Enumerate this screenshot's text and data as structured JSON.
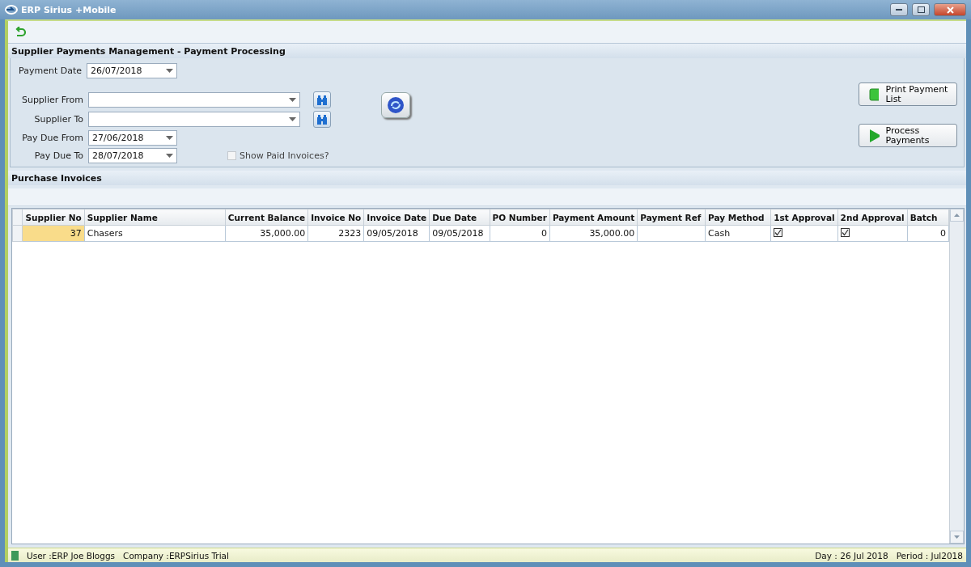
{
  "window": {
    "title": "ERP Sirius +Mobile"
  },
  "section_title": "Supplier Payments Management - Payment Processing",
  "payment_date": {
    "label": "Payment Date",
    "value": "26/07/2018"
  },
  "supplier_from": {
    "label": "Supplier From"
  },
  "supplier_to": {
    "label": "Supplier To"
  },
  "pay_due_from": {
    "label": "Pay Due From",
    "value": "27/06/2018"
  },
  "pay_due_to": {
    "label": "Pay Due To",
    "value": "28/07/2018"
  },
  "show_paid": {
    "label": "Show Paid Invoices?",
    "checked": false
  },
  "buttons": [
    {
      "kind": "print",
      "label": "Print Payment List"
    },
    {
      "kind": "process",
      "label": "Process Payments"
    }
  ],
  "invoices": {
    "title": "Purchase Invoices",
    "columns": [
      {
        "label": "Supplier No",
        "kind": "number"
      },
      {
        "label": "Supplier Name",
        "kind": "text"
      },
      {
        "label": "Current Balance",
        "kind": "number"
      },
      {
        "label": "Invoice No",
        "kind": "number"
      },
      {
        "label": "Invoice Date",
        "kind": "text"
      },
      {
        "label": "Due Date",
        "kind": "text"
      },
      {
        "label": "PO Number",
        "kind": "number"
      },
      {
        "label": "Payment Amount",
        "kind": "number"
      },
      {
        "label": "Payment Ref",
        "kind": "text"
      },
      {
        "label": "Pay Method",
        "kind": "text"
      },
      {
        "label": "1st Approval",
        "kind": "check"
      },
      {
        "label": "2nd Approval",
        "kind": "check"
      },
      {
        "label": "Batch",
        "kind": "number"
      }
    ],
    "rows": [
      {
        "cells": [
          {
            "value": "37",
            "selected": true
          },
          {
            "value": "Chasers",
            "selected": false
          },
          {
            "value": "35,000.00",
            "selected": false
          },
          {
            "value": "2323",
            "selected": false
          },
          {
            "value": "09/05/2018",
            "selected": false
          },
          {
            "value": "09/05/2018",
            "selected": false
          },
          {
            "value": "0",
            "selected": false
          },
          {
            "value": "35,000.00",
            "selected": false
          },
          {
            "selected": false
          },
          {
            "value": "Cash",
            "selected": false
          },
          {
            "checked": true,
            "selected": false
          },
          {
            "checked": true,
            "selected": false
          },
          {
            "value": "0",
            "selected": false
          }
        ]
      }
    ]
  },
  "status_bar": {
    "user": "User :ERP Joe Bloggs",
    "company": "Company :ERPSirius Trial",
    "day": "Day : 26 Jul 2018",
    "period": "Period : Jul2018"
  }
}
